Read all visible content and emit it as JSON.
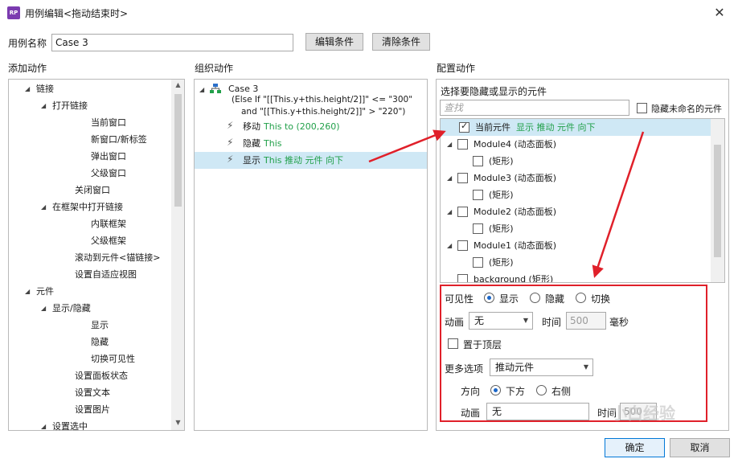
{
  "window": {
    "title": "用例编辑<拖动结束时>",
    "close_glyph": "✕",
    "icon_text": "RP"
  },
  "case": {
    "name_label": "用例名称",
    "name_value": "Case 3",
    "edit_button": "编辑条件",
    "clear_button": "清除条件"
  },
  "add_actions": {
    "header": "添加动作",
    "items": [
      {
        "label": "链接",
        "arrow": "◢"
      },
      {
        "label": "打开链接",
        "arrow": "◢"
      },
      {
        "label": "当前窗口"
      },
      {
        "label": "新窗口/新标签"
      },
      {
        "label": "弹出窗口"
      },
      {
        "label": "父级窗口"
      },
      {
        "label": "关闭窗口"
      },
      {
        "label": "在框架中打开链接",
        "arrow": "◢"
      },
      {
        "label": "内联框架"
      },
      {
        "label": "父级框架"
      },
      {
        "label": "滚动到元件<锚链接>"
      },
      {
        "label": "设置自适应视图"
      },
      {
        "label": "元件",
        "arrow": "◢"
      },
      {
        "label": "显示/隐藏",
        "arrow": "◢"
      },
      {
        "label": "显示"
      },
      {
        "label": "隐藏"
      },
      {
        "label": "切换可见性"
      },
      {
        "label": "设置面板状态"
      },
      {
        "label": "设置文本"
      },
      {
        "label": "设置图片"
      },
      {
        "label": "设置选中",
        "arrow": "◢"
      }
    ],
    "scroll_up": "▲",
    "scroll_down": "▼"
  },
  "organize": {
    "header": "组织动作",
    "case_title": "Case 3",
    "condition_line1": "(Else If \"[[This.y+this.height/2]]\" <= \"300\"",
    "condition_line2": "and \"[[This.y+this.height/2]]\" > \"220\")",
    "actions": [
      {
        "verb": "移动",
        "detail": "This to (200,260)"
      },
      {
        "verb": "隐藏",
        "detail": "This"
      },
      {
        "verb": "显示",
        "detail": "This 推动 元件 向下"
      }
    ],
    "expand_arrow": "◢",
    "bolt_glyph": "⚡"
  },
  "config": {
    "header": "配置动作",
    "widgets_label": "选择要隐藏或显示的元件",
    "search_placeholder": "查找",
    "hide_unnamed_label": "隐藏未命名的元件",
    "widgets": [
      {
        "label": "当前元件",
        "detail": "显示 推动 元件 向下",
        "checked": true
      },
      {
        "label": "Module4 (动态面板)",
        "arrow": "◢"
      },
      {
        "label": "(矩形)"
      },
      {
        "label": "Module3 (动态面板)",
        "arrow": "◢"
      },
      {
        "label": "(矩形)"
      },
      {
        "label": "Module2 (动态面板)",
        "arrow": "◢"
      },
      {
        "label": "(矩形)"
      },
      {
        "label": "Module1 (动态面板)",
        "arrow": "◢"
      },
      {
        "label": "(矩形)"
      },
      {
        "label": "background (矩形)"
      }
    ],
    "visibility_label": "可见性",
    "vis_show": "显示",
    "vis_hide": "隐藏",
    "vis_toggle": "切换",
    "animation_label": "动画",
    "animation_value": "无",
    "time_label": "时间",
    "time_value": "500",
    "ms_label": "毫秒",
    "bring_front_label": "置于顶层",
    "more_options_label": "更多选项",
    "more_options_value": "推动元件",
    "direction_label": "方向",
    "dir_down": "下方",
    "dir_right": "右侧",
    "push_anim_label": "动画",
    "push_anim_value": "无",
    "push_time_label": "时间",
    "push_time_value": "500",
    "combo_arrow": "▼"
  },
  "footer": {
    "ok": "确定",
    "cancel": "取消"
  },
  "watermark": "小白经验",
  "colors": {
    "green": "#22a04a",
    "red": "#e0202a",
    "selected": "#cfe8f5",
    "accent": "#1a66c9"
  }
}
